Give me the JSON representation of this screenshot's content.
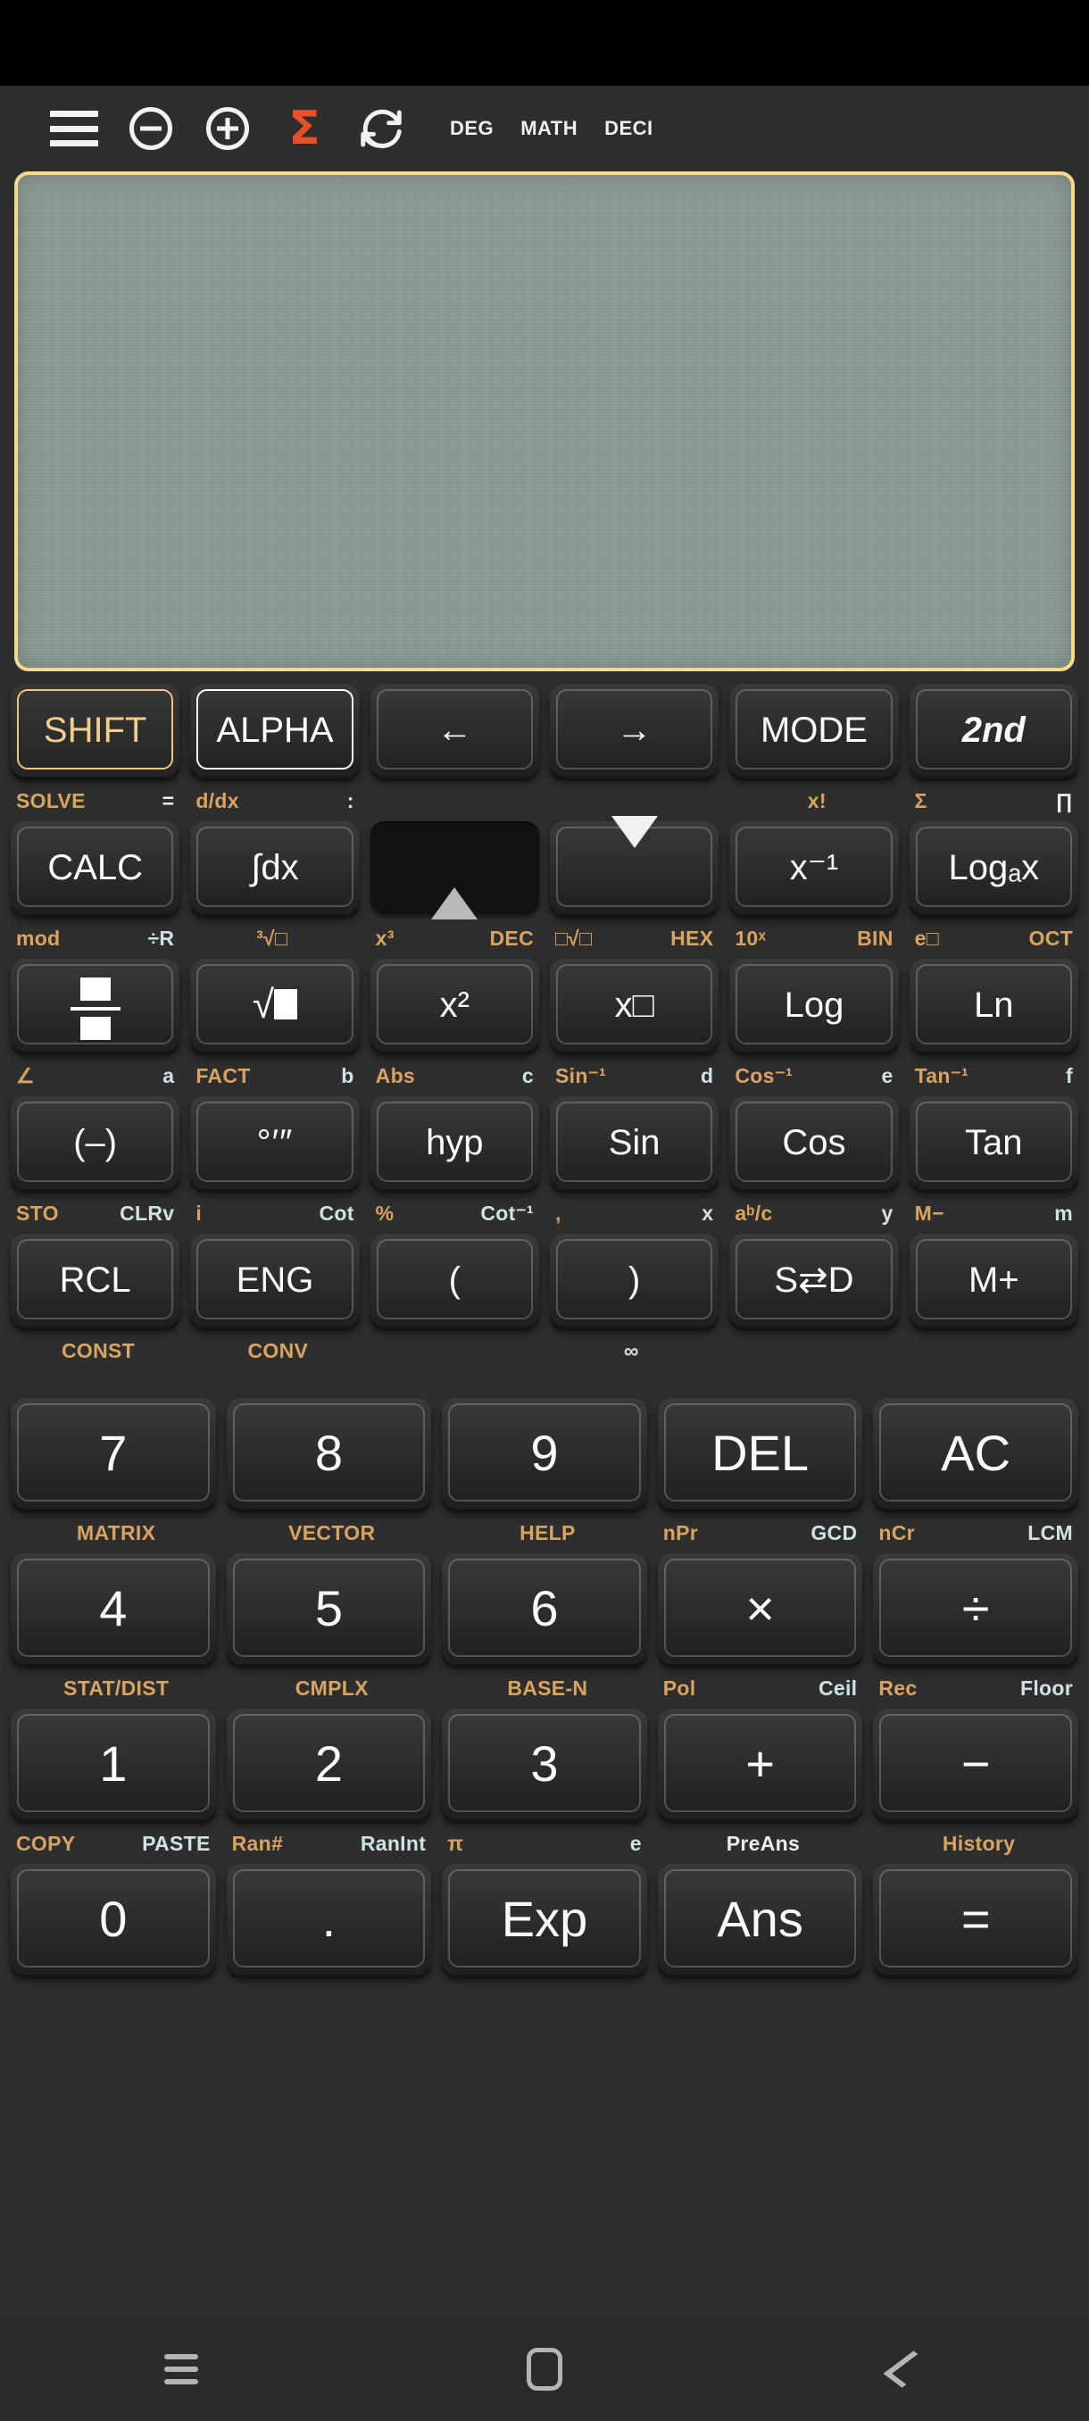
{
  "statusbar": {
    "present": true
  },
  "toolbar": {
    "menu_icon": "hamburger-menu-icon",
    "zoom_out_icon": "minus-circle-icon",
    "zoom_in_icon": "plus-circle-icon",
    "sigma_icon": "sigma-icon",
    "refresh_icon": "refresh-icon",
    "sigma_color": "#e8502a",
    "flags": [
      "DEG",
      "MATH",
      "DECI"
    ]
  },
  "display": {
    "value": "",
    "bg_color": "#919e96",
    "border_color": "#f5d98f"
  },
  "keypad": {
    "rows": [
      {
        "keys": [
          {
            "label": "SHIFT",
            "style": "shift"
          },
          {
            "label": "ALPHA",
            "style": "alpha"
          },
          {
            "label": "←",
            "style": "plain"
          },
          {
            "label": "→",
            "style": "plain"
          },
          {
            "label": "MODE",
            "style": "plain"
          },
          {
            "label": "2nd",
            "style": "italic"
          }
        ],
        "subs": [
          {
            "left": "SOLVE",
            "right": "=",
            "lc": "o",
            "rc": "w"
          },
          {
            "left": "d/dx",
            "right": ":",
            "lc": "o",
            "rc": "w"
          },
          {
            "left": "",
            "right": "",
            "lc": "o",
            "rc": "w"
          },
          {
            "left": "",
            "right": "",
            "lc": "o",
            "rc": "w"
          },
          {
            "left": "",
            "right": "x!",
            "lc": "o",
            "rc": "o"
          },
          {
            "left": "Σ",
            "right": "∏",
            "lc": "o",
            "rc": "w"
          }
        ]
      },
      {
        "keys": [
          {
            "label": "CALC",
            "style": "plain"
          },
          {
            "label": "∫dx",
            "style": "plain"
          },
          {
            "label": "▲",
            "style": "pressed-up"
          },
          {
            "label": "▼",
            "style": "down"
          },
          {
            "label": "x⁻¹",
            "style": "plain"
          },
          {
            "label": "Logₐx",
            "style": "plain"
          }
        ],
        "subs": [
          {
            "left": "mod",
            "right": "÷R",
            "lc": "o",
            "rc": "c"
          },
          {
            "left": "³√□",
            "right": "",
            "lc": "o",
            "rc": "w"
          },
          {
            "left": "x³",
            "right": "DEC",
            "lc": "o",
            "rc": "o"
          },
          {
            "left": "□√□",
            "right": "HEX",
            "lc": "o",
            "rc": "o"
          },
          {
            "left": "10ˣ",
            "right": "BIN",
            "lc": "o",
            "rc": "o"
          },
          {
            "left": "e□",
            "right": "OCT",
            "lc": "o",
            "rc": "o"
          }
        ]
      },
      {
        "keys": [
          {
            "label": "fraction",
            "style": "glyph-frac"
          },
          {
            "label": "sqrt",
            "style": "glyph-sqrt"
          },
          {
            "label": "x²",
            "style": "plain"
          },
          {
            "label": "x□",
            "style": "plain"
          },
          {
            "label": "Log",
            "style": "plain"
          },
          {
            "label": "Ln",
            "style": "plain"
          }
        ],
        "subs": [
          {
            "left": "∠",
            "right": "a",
            "lc": "o",
            "rc": "c"
          },
          {
            "left": "FACT",
            "right": "b",
            "lc": "o",
            "rc": "c"
          },
          {
            "left": "Abs",
            "right": "c",
            "lc": "o",
            "rc": "c"
          },
          {
            "left": "Sin⁻¹",
            "right": "d",
            "lc": "o",
            "rc": "c"
          },
          {
            "left": "Cos⁻¹",
            "right": "e",
            "lc": "o",
            "rc": "c"
          },
          {
            "left": "Tan⁻¹",
            "right": "f",
            "lc": "o",
            "rc": "c"
          }
        ]
      },
      {
        "keys": [
          {
            "label": "(–)",
            "style": "plain"
          },
          {
            "label": "°′″",
            "style": "dms"
          },
          {
            "label": "hyp",
            "style": "plain"
          },
          {
            "label": "Sin",
            "style": "plain"
          },
          {
            "label": "Cos",
            "style": "plain"
          },
          {
            "label": "Tan",
            "style": "plain"
          }
        ],
        "subs": [
          {
            "left": "STO",
            "right": "CLRv",
            "lc": "o",
            "rc": "c"
          },
          {
            "left": "i",
            "right": "Cot",
            "lc": "o",
            "rc": "c"
          },
          {
            "left": "%",
            "right": "Cot⁻¹",
            "lc": "o",
            "rc": "c"
          },
          {
            "left": ",",
            "right": "x",
            "lc": "o",
            "rc": "c"
          },
          {
            "left": "aᵇ/c",
            "right": "y",
            "lc": "o",
            "rc": "c"
          },
          {
            "left": "M−",
            "right": "m",
            "lc": "o",
            "rc": "c"
          }
        ]
      },
      {
        "keys": [
          {
            "label": "RCL",
            "style": "plain"
          },
          {
            "label": "ENG",
            "style": "plain"
          },
          {
            "label": "(",
            "style": "plain"
          },
          {
            "label": ")",
            "style": "plain"
          },
          {
            "label": "S⇄D",
            "style": "plain"
          },
          {
            "label": "M+",
            "style": "plain"
          }
        ],
        "subs": [
          {
            "left": "",
            "right": "CONST",
            "lc": "o",
            "rc": "o"
          },
          {
            "left": "",
            "right": "CONV",
            "lc": "o",
            "rc": "o"
          },
          {
            "left": "",
            "right": "",
            "lc": "o",
            "rc": "w"
          },
          {
            "left": "∞",
            "right": "",
            "lc": "c",
            "rc": "w"
          },
          {
            "left": "",
            "right": "",
            "lc": "o",
            "rc": "w"
          },
          {
            "left": "",
            "right": "",
            "lc": "o",
            "rc": "w"
          }
        ]
      }
    ],
    "numrows": [
      {
        "keys": [
          {
            "label": "7"
          },
          {
            "label": "8"
          },
          {
            "label": "9"
          },
          {
            "label": "DEL"
          },
          {
            "label": "AC"
          }
        ],
        "subs": [
          {
            "left": "",
            "right": "MATRIX",
            "lc": "o",
            "rc": "o"
          },
          {
            "left": "",
            "right": "VECTOR",
            "lc": "o",
            "rc": "o"
          },
          {
            "left": "",
            "right": "HELP",
            "lc": "o",
            "rc": "o"
          },
          {
            "left": "nPr",
            "right": "GCD",
            "lc": "o",
            "rc": "c"
          },
          {
            "left": "nCr",
            "right": "LCM",
            "lc": "o",
            "rc": "c"
          }
        ]
      },
      {
        "keys": [
          {
            "label": "4"
          },
          {
            "label": "5"
          },
          {
            "label": "6"
          },
          {
            "label": "×"
          },
          {
            "label": "÷"
          }
        ],
        "subs": [
          {
            "left": "",
            "right": "STAT/DIST",
            "lc": "o",
            "rc": "o"
          },
          {
            "left": "",
            "right": "CMPLX",
            "lc": "o",
            "rc": "o"
          },
          {
            "left": "",
            "right": "BASE-N",
            "lc": "o",
            "rc": "o"
          },
          {
            "left": "Pol",
            "right": "Ceil",
            "lc": "o",
            "rc": "c"
          },
          {
            "left": "Rec",
            "right": "Floor",
            "lc": "o",
            "rc": "c"
          }
        ]
      },
      {
        "keys": [
          {
            "label": "1"
          },
          {
            "label": "2"
          },
          {
            "label": "3"
          },
          {
            "label": "+"
          },
          {
            "label": "−"
          }
        ],
        "subs": [
          {
            "left": "COPY",
            "right": "PASTE",
            "lc": "o",
            "rc": "c"
          },
          {
            "left": "Ran#",
            "right": "RanInt",
            "lc": "o",
            "rc": "c"
          },
          {
            "left": "π",
            "right": "e",
            "lc": "o",
            "rc": "c"
          },
          {
            "left": "",
            "right": "PreAns",
            "lc": "o",
            "rc": "w"
          },
          {
            "left": "",
            "right": "History",
            "lc": "o",
            "rc": "o"
          }
        ]
      },
      {
        "keys": [
          {
            "label": "0"
          },
          {
            "label": "."
          },
          {
            "label": "Exp"
          },
          {
            "label": "Ans"
          },
          {
            "label": "="
          }
        ],
        "subs": [
          {
            "left": "",
            "right": "",
            "lc": "o",
            "rc": "w"
          },
          {
            "left": "",
            "right": "",
            "lc": "o",
            "rc": "w"
          },
          {
            "left": "",
            "right": "",
            "lc": "o",
            "rc": "w"
          },
          {
            "left": "",
            "right": "",
            "lc": "o",
            "rc": "w"
          },
          {
            "left": "",
            "right": "",
            "lc": "o",
            "rc": "w"
          }
        ]
      }
    ]
  },
  "navbar": {
    "recents_icon": "recents-icon",
    "home_icon": "home-icon",
    "back_icon": "back-icon"
  }
}
